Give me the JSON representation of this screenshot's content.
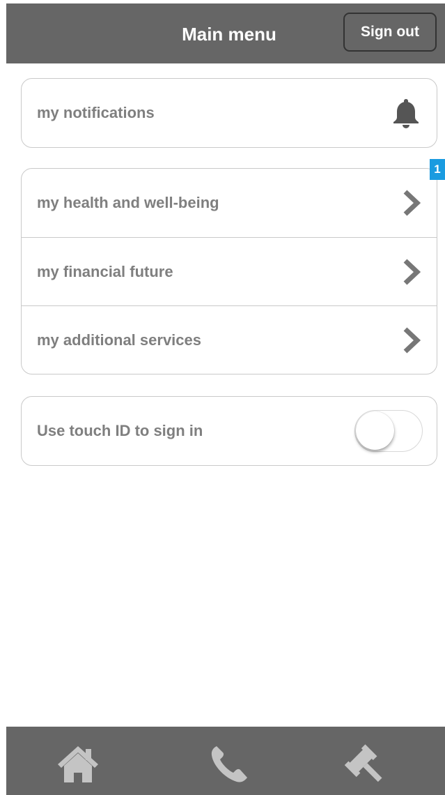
{
  "header": {
    "title": "Main menu",
    "sign_out_label": "Sign out"
  },
  "notifications": {
    "label": "my notifications",
    "icon": "bell-icon"
  },
  "menu": {
    "badge_count": "1",
    "items": [
      {
        "label": "my health and well-being",
        "icon": "chevron-right-icon"
      },
      {
        "label": "my financial future",
        "icon": "chevron-right-icon"
      },
      {
        "label": "my additional services",
        "icon": "chevron-right-icon"
      }
    ]
  },
  "settings": {
    "touch_id_label": "Use touch ID to sign in",
    "touch_id_enabled": false
  },
  "footer": {
    "icons": [
      "home-icon",
      "phone-icon",
      "gavel-icon"
    ]
  },
  "colors": {
    "bar": "#666666",
    "text": "#7f7f7f",
    "border": "#c9c9c9",
    "badge": "#1a9be0"
  }
}
